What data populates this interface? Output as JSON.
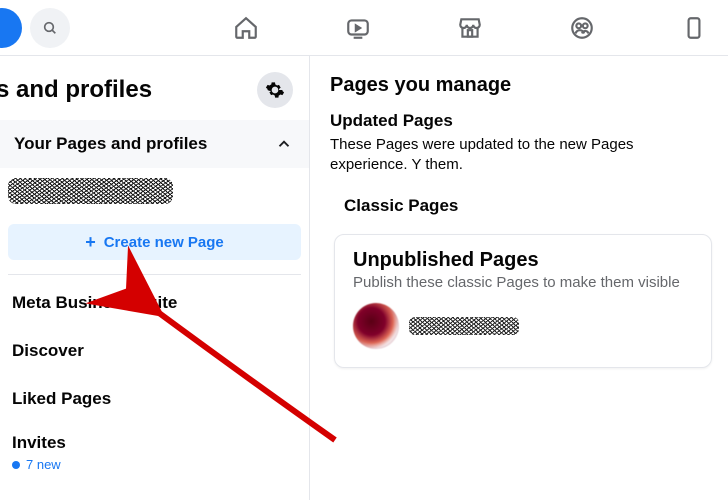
{
  "sidebar": {
    "title": "ges and profiles",
    "expander_label": "Your Pages and profiles",
    "create_label": "Create new Page",
    "items": [
      {
        "label": "Meta Business Suite"
      },
      {
        "label": "Discover"
      },
      {
        "label": "Liked Pages"
      }
    ],
    "invites": {
      "label": "Invites",
      "sub": "7 new"
    }
  },
  "main": {
    "manage_title": "Pages you manage",
    "updated_title": "Updated Pages",
    "updated_desc": "These Pages were updated to the new Pages experience. Y them.",
    "classic_title": "Classic Pages",
    "card": {
      "title": "Unpublished Pages",
      "desc": "Publish these classic Pages to make them visible"
    }
  }
}
